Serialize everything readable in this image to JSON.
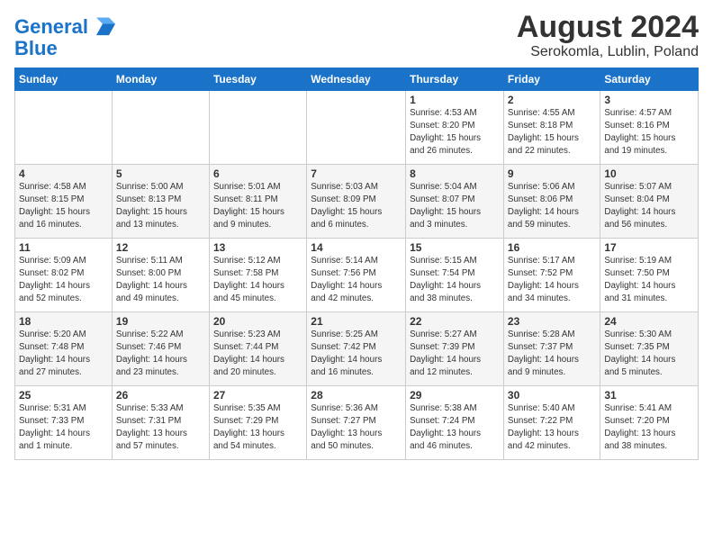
{
  "logo": {
    "line1": "General",
    "line2": "Blue"
  },
  "title": "August 2024",
  "subtitle": "Serokomla, Lublin, Poland",
  "weekdays": [
    "Sunday",
    "Monday",
    "Tuesday",
    "Wednesday",
    "Thursday",
    "Friday",
    "Saturday"
  ],
  "weeks": [
    [
      {
        "day": "",
        "info": ""
      },
      {
        "day": "",
        "info": ""
      },
      {
        "day": "",
        "info": ""
      },
      {
        "day": "",
        "info": ""
      },
      {
        "day": "1",
        "info": "Sunrise: 4:53 AM\nSunset: 8:20 PM\nDaylight: 15 hours\nand 26 minutes."
      },
      {
        "day": "2",
        "info": "Sunrise: 4:55 AM\nSunset: 8:18 PM\nDaylight: 15 hours\nand 22 minutes."
      },
      {
        "day": "3",
        "info": "Sunrise: 4:57 AM\nSunset: 8:16 PM\nDaylight: 15 hours\nand 19 minutes."
      }
    ],
    [
      {
        "day": "4",
        "info": "Sunrise: 4:58 AM\nSunset: 8:15 PM\nDaylight: 15 hours\nand 16 minutes."
      },
      {
        "day": "5",
        "info": "Sunrise: 5:00 AM\nSunset: 8:13 PM\nDaylight: 15 hours\nand 13 minutes."
      },
      {
        "day": "6",
        "info": "Sunrise: 5:01 AM\nSunset: 8:11 PM\nDaylight: 15 hours\nand 9 minutes."
      },
      {
        "day": "7",
        "info": "Sunrise: 5:03 AM\nSunset: 8:09 PM\nDaylight: 15 hours\nand 6 minutes."
      },
      {
        "day": "8",
        "info": "Sunrise: 5:04 AM\nSunset: 8:07 PM\nDaylight: 15 hours\nand 3 minutes."
      },
      {
        "day": "9",
        "info": "Sunrise: 5:06 AM\nSunset: 8:06 PM\nDaylight: 14 hours\nand 59 minutes."
      },
      {
        "day": "10",
        "info": "Sunrise: 5:07 AM\nSunset: 8:04 PM\nDaylight: 14 hours\nand 56 minutes."
      }
    ],
    [
      {
        "day": "11",
        "info": "Sunrise: 5:09 AM\nSunset: 8:02 PM\nDaylight: 14 hours\nand 52 minutes."
      },
      {
        "day": "12",
        "info": "Sunrise: 5:11 AM\nSunset: 8:00 PM\nDaylight: 14 hours\nand 49 minutes."
      },
      {
        "day": "13",
        "info": "Sunrise: 5:12 AM\nSunset: 7:58 PM\nDaylight: 14 hours\nand 45 minutes."
      },
      {
        "day": "14",
        "info": "Sunrise: 5:14 AM\nSunset: 7:56 PM\nDaylight: 14 hours\nand 42 minutes."
      },
      {
        "day": "15",
        "info": "Sunrise: 5:15 AM\nSunset: 7:54 PM\nDaylight: 14 hours\nand 38 minutes."
      },
      {
        "day": "16",
        "info": "Sunrise: 5:17 AM\nSunset: 7:52 PM\nDaylight: 14 hours\nand 34 minutes."
      },
      {
        "day": "17",
        "info": "Sunrise: 5:19 AM\nSunset: 7:50 PM\nDaylight: 14 hours\nand 31 minutes."
      }
    ],
    [
      {
        "day": "18",
        "info": "Sunrise: 5:20 AM\nSunset: 7:48 PM\nDaylight: 14 hours\nand 27 minutes."
      },
      {
        "day": "19",
        "info": "Sunrise: 5:22 AM\nSunset: 7:46 PM\nDaylight: 14 hours\nand 23 minutes."
      },
      {
        "day": "20",
        "info": "Sunrise: 5:23 AM\nSunset: 7:44 PM\nDaylight: 14 hours\nand 20 minutes."
      },
      {
        "day": "21",
        "info": "Sunrise: 5:25 AM\nSunset: 7:42 PM\nDaylight: 14 hours\nand 16 minutes."
      },
      {
        "day": "22",
        "info": "Sunrise: 5:27 AM\nSunset: 7:39 PM\nDaylight: 14 hours\nand 12 minutes."
      },
      {
        "day": "23",
        "info": "Sunrise: 5:28 AM\nSunset: 7:37 PM\nDaylight: 14 hours\nand 9 minutes."
      },
      {
        "day": "24",
        "info": "Sunrise: 5:30 AM\nSunset: 7:35 PM\nDaylight: 14 hours\nand 5 minutes."
      }
    ],
    [
      {
        "day": "25",
        "info": "Sunrise: 5:31 AM\nSunset: 7:33 PM\nDaylight: 14 hours\nand 1 minute."
      },
      {
        "day": "26",
        "info": "Sunrise: 5:33 AM\nSunset: 7:31 PM\nDaylight: 13 hours\nand 57 minutes."
      },
      {
        "day": "27",
        "info": "Sunrise: 5:35 AM\nSunset: 7:29 PM\nDaylight: 13 hours\nand 54 minutes."
      },
      {
        "day": "28",
        "info": "Sunrise: 5:36 AM\nSunset: 7:27 PM\nDaylight: 13 hours\nand 50 minutes."
      },
      {
        "day": "29",
        "info": "Sunrise: 5:38 AM\nSunset: 7:24 PM\nDaylight: 13 hours\nand 46 minutes."
      },
      {
        "day": "30",
        "info": "Sunrise: 5:40 AM\nSunset: 7:22 PM\nDaylight: 13 hours\nand 42 minutes."
      },
      {
        "day": "31",
        "info": "Sunrise: 5:41 AM\nSunset: 7:20 PM\nDaylight: 13 hours\nand 38 minutes."
      }
    ]
  ]
}
